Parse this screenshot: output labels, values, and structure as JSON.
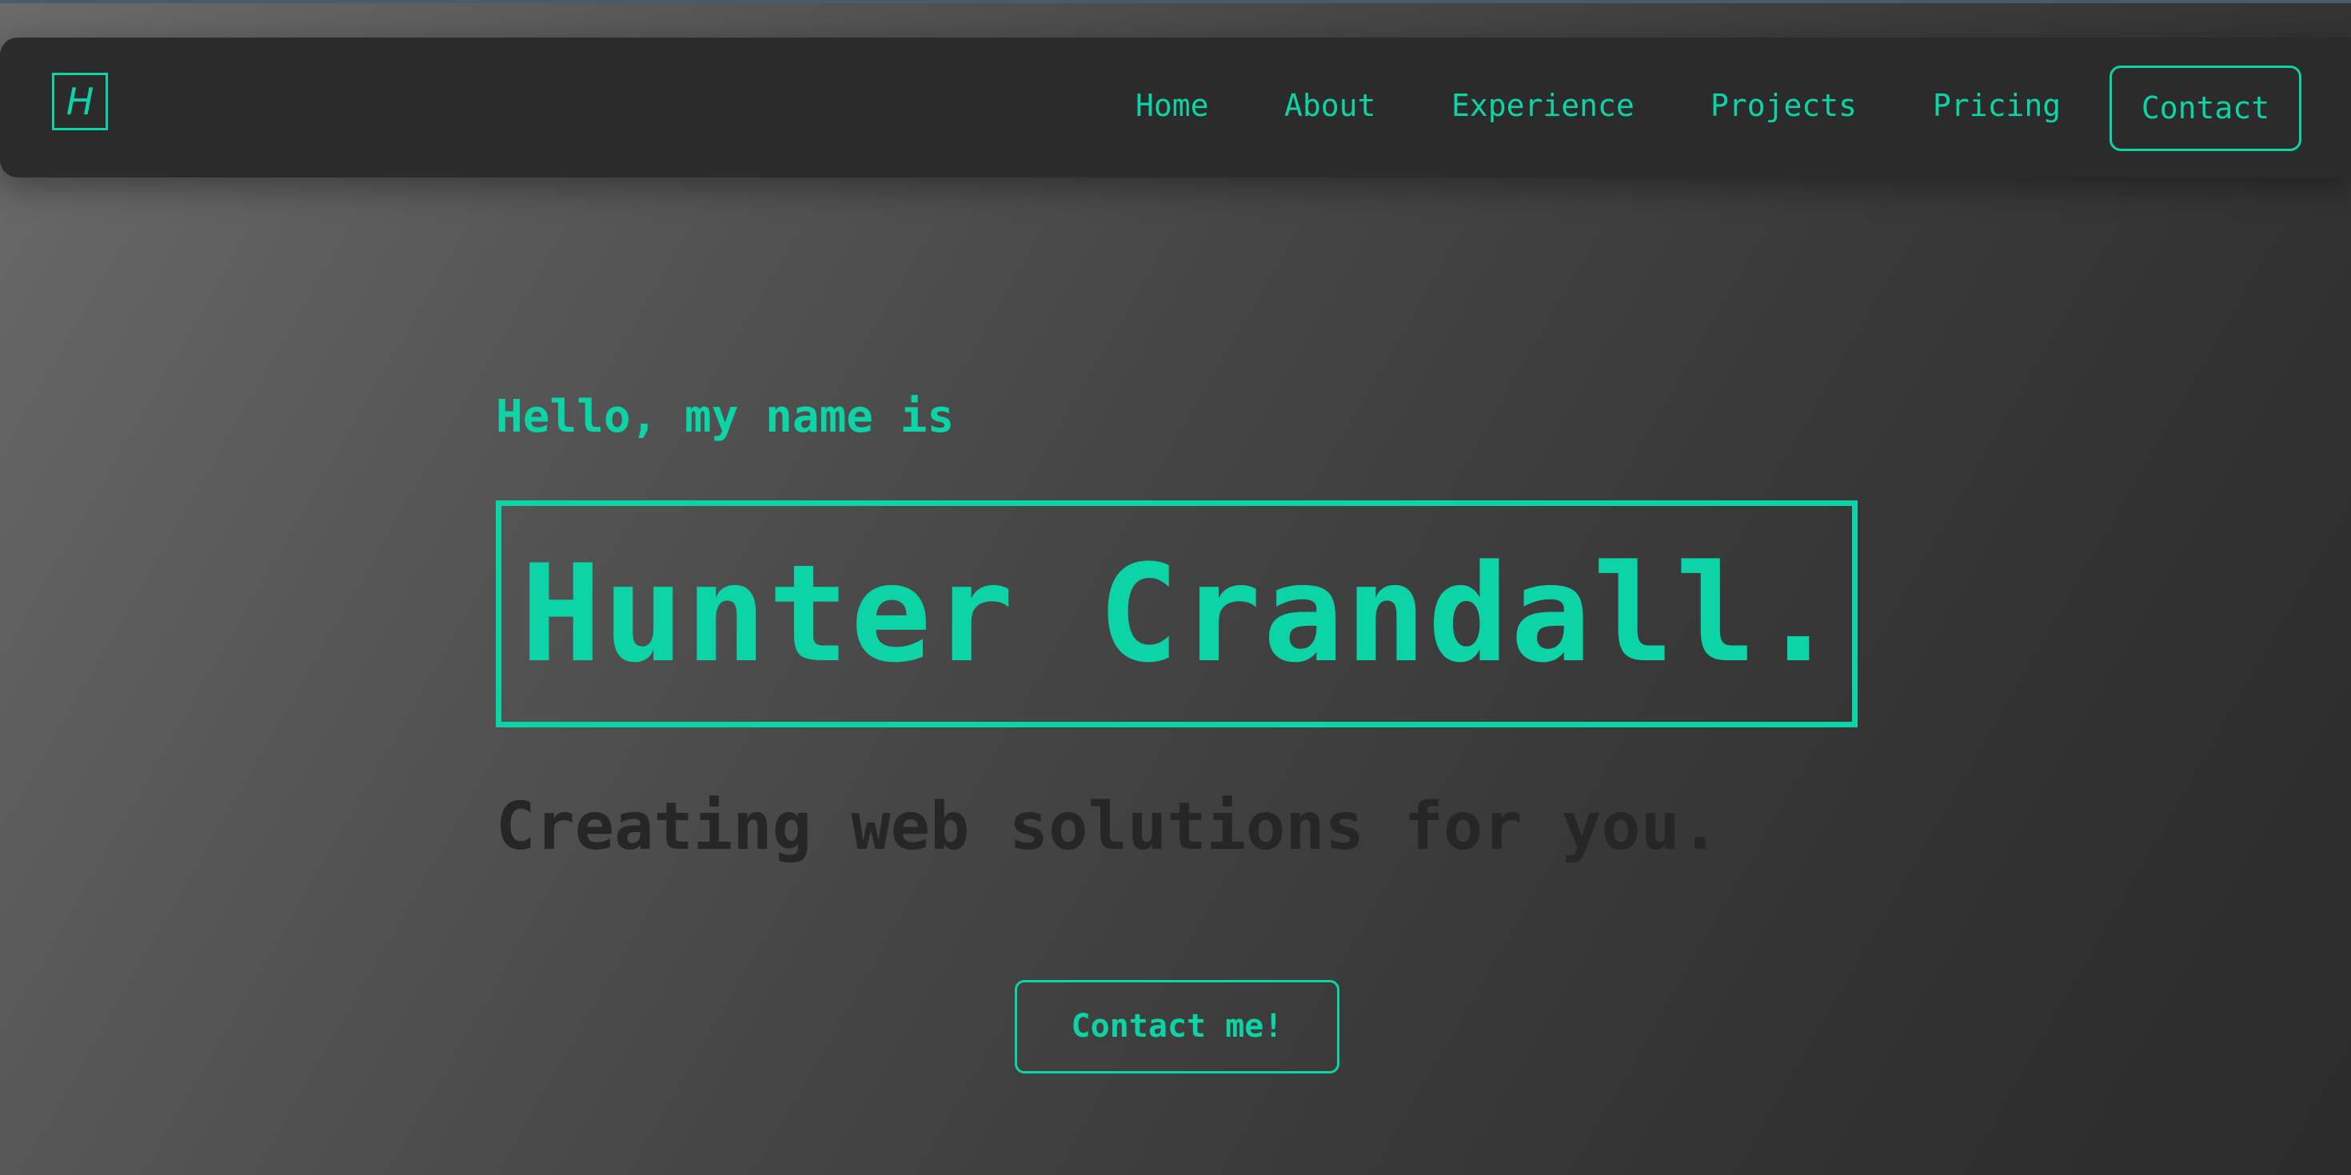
{
  "nav": {
    "logo_text": "H",
    "items": [
      {
        "label": "Home"
      },
      {
        "label": "About"
      },
      {
        "label": "Experience"
      },
      {
        "label": "Projects"
      },
      {
        "label": "Pricing"
      }
    ],
    "contact_label": "Contact"
  },
  "hero": {
    "greeting": "Hello, my name is",
    "name": "Hunter Crandall.",
    "tagline": "Creating web solutions for you.",
    "cta_label": "Contact me!"
  },
  "colors": {
    "accent": "#0cd4a6",
    "navbar_bg": "#2b2b2b",
    "tagline_text": "#262626"
  }
}
